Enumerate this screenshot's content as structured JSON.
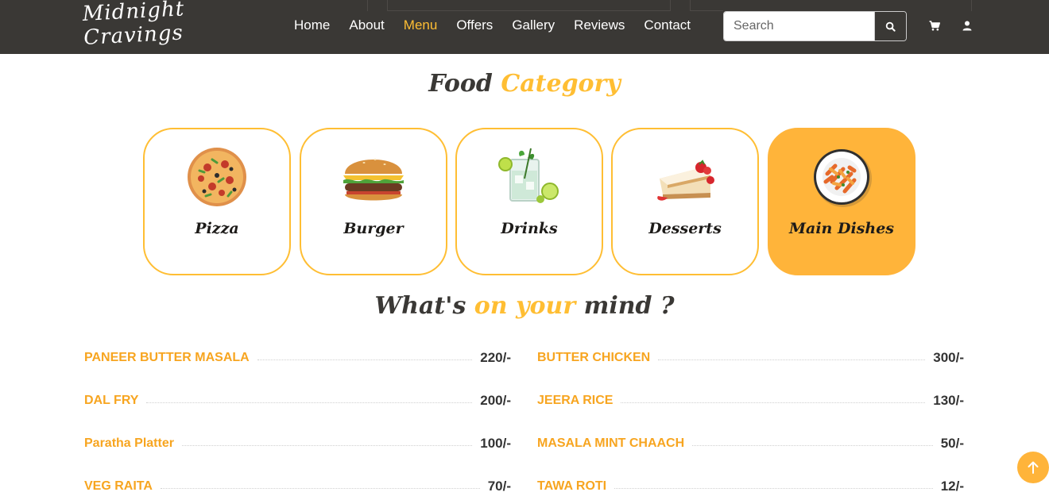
{
  "brand": {
    "line1": "Midnight",
    "line2": "Cravings"
  },
  "nav": [
    {
      "label": "Home",
      "active": false
    },
    {
      "label": "About",
      "active": false
    },
    {
      "label": "Menu",
      "active": true
    },
    {
      "label": "Offers",
      "active": false
    },
    {
      "label": "Gallery",
      "active": false
    },
    {
      "label": "Reviews",
      "active": false
    },
    {
      "label": "Contact",
      "active": false
    }
  ],
  "search": {
    "placeholder": "Search",
    "icon": "search-icon"
  },
  "header_icons": [
    "cart-icon",
    "user-icon"
  ],
  "category_section": {
    "title_part1": "Food",
    "title_part2": "Category"
  },
  "categories": [
    {
      "label": "Pizza",
      "icon": "pizza-image",
      "active": false
    },
    {
      "label": "Burger",
      "icon": "burger-image",
      "active": false
    },
    {
      "label": "Drinks",
      "icon": "drinks-image",
      "active": false
    },
    {
      "label": "Desserts",
      "icon": "desserts-image",
      "active": false
    },
    {
      "label": "Main Dishes",
      "icon": "main-dishes-image",
      "active": true
    }
  ],
  "mind_section": {
    "title_part1": "What's",
    "title_part2": "on your",
    "title_part3": "mind ?"
  },
  "menu_items_left": [
    {
      "name": "PANEER BUTTER MASALA",
      "price": "220/-"
    },
    {
      "name": "DAL FRY",
      "price": "200/-"
    },
    {
      "name": "Paratha Platter",
      "price": "100/-"
    },
    {
      "name": "VEG RAITA",
      "price": "70/-"
    }
  ],
  "menu_items_right": [
    {
      "name": "BUTTER CHICKEN",
      "price": "300/-"
    },
    {
      "name": "JEERA RICE",
      "price": "130/-"
    },
    {
      "name": "MASALA MINT CHAACH",
      "price": "50/-"
    },
    {
      "name": "TAWA ROTI",
      "price": "12/-"
    }
  ],
  "colors": {
    "accent": "#ffbe33",
    "header_bg": "#3a3835",
    "item_name": "#f7a520"
  },
  "scroll_top_icon": "arrow-up-icon"
}
